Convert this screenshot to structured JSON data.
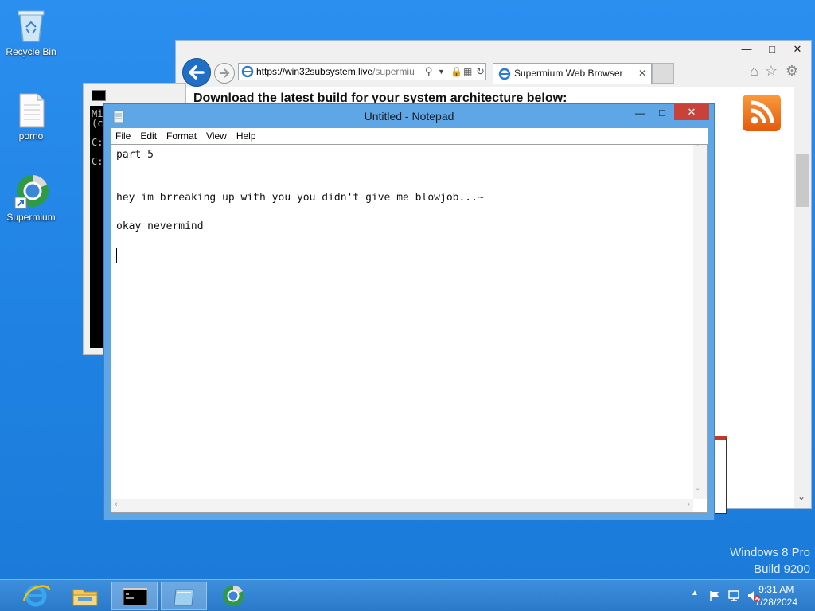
{
  "desktop": {
    "icons": [
      {
        "label": "Recycle Bin"
      },
      {
        "label": "porno"
      },
      {
        "label": "Supermium"
      }
    ]
  },
  "browser": {
    "url_host": "https://win32subsystem.live",
    "url_path": "/supermiu",
    "tab_title": "Supermium Web Browser",
    "page_heading": "Download the latest build for your system architecture below:"
  },
  "console": {
    "lines": [
      "Mi",
      "(c",
      "",
      "C:",
      "",
      "C:"
    ]
  },
  "notepad": {
    "title": "Untitled - Notepad",
    "menu": [
      "File",
      "Edit",
      "Format",
      "View",
      "Help"
    ],
    "text": "part 5\n\n\nhey im brreaking up with you you didn't give me blowjob...~\n\nokay nevermind"
  },
  "watermark": {
    "line1": "Windows 8 Pro",
    "line2": "Build 9200"
  },
  "taskbar": {
    "time": "9:31 AM",
    "date": "7/28/2024"
  },
  "colors": {
    "desktop": "#1f82e2",
    "notepad_frame": "#5fa6e7",
    "close_red": "#c9423a",
    "taskbar": "#2a79c9"
  }
}
